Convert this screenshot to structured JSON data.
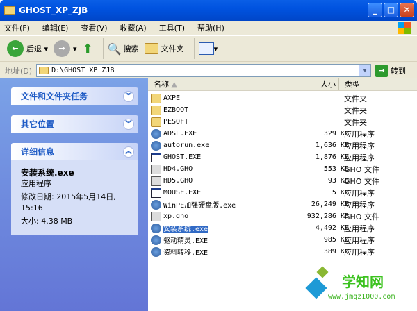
{
  "window": {
    "title": "GHOST_XP_ZJB"
  },
  "menu": [
    "文件(F)",
    "编辑(E)",
    "查看(V)",
    "收藏(A)",
    "工具(T)",
    "帮助(H)"
  ],
  "toolbar": {
    "back": "后退",
    "search": "搜索",
    "folders": "文件夹"
  },
  "address": {
    "label": "地址(D)",
    "value": "D:\\GHOST_XP_ZJB",
    "go": "转到"
  },
  "panels": [
    {
      "title": "文件和文件夹任务"
    },
    {
      "title": "其它位置"
    },
    {
      "title": "详细信息"
    }
  ],
  "details": {
    "name": "安装系统.exe",
    "type": "应用程序",
    "modified": "修改日期: 2015年5月14日, 15:16",
    "size": "大小: 4.38 MB"
  },
  "columns": {
    "name": "名称",
    "size": "大小",
    "type": "类型"
  },
  "files": [
    {
      "name": "AXPE",
      "size": "",
      "type": "文件夹",
      "icon": "folder"
    },
    {
      "name": "EZBOOT",
      "size": "",
      "type": "文件夹",
      "icon": "folder"
    },
    {
      "name": "PESOFT",
      "size": "",
      "type": "文件夹",
      "icon": "folder"
    },
    {
      "name": "ADSL.EXE",
      "size": "329 KB",
      "type": "应用程序",
      "icon": "app"
    },
    {
      "name": "autorun.exe",
      "size": "1,636 KB",
      "type": "应用程序",
      "icon": "app"
    },
    {
      "name": "GHOST.EXE",
      "size": "1,876 KB",
      "type": "应用程序",
      "icon": "exe"
    },
    {
      "name": "HD4.GHO",
      "size": "553 KB",
      "type": "GHO 文件",
      "icon": "gho"
    },
    {
      "name": "HD5.GHO",
      "size": "93 KB",
      "type": "GHO 文件",
      "icon": "gho"
    },
    {
      "name": "MOUSE.EXE",
      "size": "5 KB",
      "type": "应用程序",
      "icon": "exe"
    },
    {
      "name": "WinPE加强硬盘版.exe",
      "size": "26,249 KB",
      "type": "应用程序",
      "icon": "app"
    },
    {
      "name": "xp.gho",
      "size": "932,286 KB",
      "type": "GHO 文件",
      "icon": "gho"
    },
    {
      "name": "安装系统.exe",
      "size": "4,492 KB",
      "type": "应用程序",
      "icon": "app",
      "selected": true
    },
    {
      "name": "驱动精灵.EXE",
      "size": "985 KB",
      "type": "应用程序",
      "icon": "app"
    },
    {
      "name": "资料转移.EXE",
      "size": "389 KB",
      "type": "应用程序",
      "icon": "app"
    }
  ],
  "watermark": {
    "title": "学知网",
    "url": "www.jmqz1000.com"
  }
}
